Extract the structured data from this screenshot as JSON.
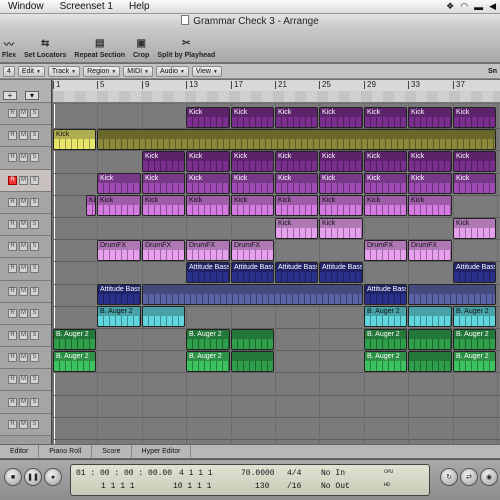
{
  "menubar": {
    "items": [
      "Window",
      "Screenset 1",
      "Help"
    ]
  },
  "window": {
    "title": "Grammar Check 3 - Arrange"
  },
  "toolbar": {
    "buttons": [
      {
        "label": "Flex",
        "icon": "flex-icon"
      },
      {
        "label": "Set Locators",
        "icon": "set-locators-icon"
      },
      {
        "label": "Repeat Section",
        "icon": "repeat-section-icon"
      },
      {
        "label": "Crop",
        "icon": "crop-icon"
      },
      {
        "label": "Split by Playhead",
        "icon": "split-icon"
      }
    ]
  },
  "arrange_menus": [
    "Edit",
    "Track",
    "Region",
    "MIDI",
    "Audio",
    "View"
  ],
  "arrange_first": "4",
  "snap_label": "Sn",
  "ruler": {
    "bars": [
      "1",
      "5",
      "9",
      "13",
      "17",
      "21",
      "25",
      "29",
      "33",
      "37"
    ]
  },
  "tracks": [
    {
      "selected": false,
      "record": false
    },
    {
      "selected": false,
      "record": false
    },
    {
      "selected": false,
      "record": false
    },
    {
      "selected": true,
      "record": true
    },
    {
      "selected": false,
      "record": false
    },
    {
      "selected": false,
      "record": false
    },
    {
      "selected": false,
      "record": false
    },
    {
      "selected": false,
      "record": false
    },
    {
      "selected": false,
      "record": false
    },
    {
      "selected": false,
      "record": false
    },
    {
      "selected": false,
      "record": false
    },
    {
      "selected": false,
      "record": false
    },
    {
      "selected": false,
      "record": false
    },
    {
      "selected": false,
      "record": false
    },
    {
      "selected": false,
      "record": false
    }
  ],
  "colors": {
    "purple": "#7a2f8f",
    "purple_light": "#a04bb5",
    "olive": "#8c8a3a",
    "yellow": "#e8e66a",
    "magenta": "#d47ae0",
    "pink_light": "#e7a0ee",
    "navy": "#2a2f8a",
    "blue_muted": "#5a63a6",
    "cyan": "#5fd7dd",
    "green": "#2e9e4a",
    "green_light": "#3cc25e"
  },
  "regions": [
    {
      "track": 0,
      "start": 13,
      "end": 17,
      "name": "Kick",
      "color": "purple"
    },
    {
      "track": 0,
      "start": 17,
      "end": 21,
      "name": "Kick",
      "color": "purple"
    },
    {
      "track": 0,
      "start": 21,
      "end": 25,
      "name": "Kick",
      "color": "purple"
    },
    {
      "track": 0,
      "start": 25,
      "end": 29,
      "name": "Kick",
      "color": "purple"
    },
    {
      "track": 0,
      "start": 29,
      "end": 33,
      "name": "Kick",
      "color": "purple"
    },
    {
      "track": 0,
      "start": 33,
      "end": 37,
      "name": "Kick",
      "color": "purple"
    },
    {
      "track": 0,
      "start": 37,
      "end": 41,
      "name": "Kick",
      "color": "purple"
    },
    {
      "track": 1,
      "start": 1,
      "end": 5,
      "name": "Kick",
      "color": "yellow"
    },
    {
      "track": 1,
      "start": 5,
      "end": 41,
      "name": "",
      "color": "olive"
    },
    {
      "track": 2,
      "start": 9,
      "end": 13,
      "name": "Kick",
      "color": "purple"
    },
    {
      "track": 2,
      "start": 13,
      "end": 17,
      "name": "Kick",
      "color": "purple"
    },
    {
      "track": 2,
      "start": 17,
      "end": 21,
      "name": "Kick",
      "color": "purple"
    },
    {
      "track": 2,
      "start": 21,
      "end": 25,
      "name": "Kick",
      "color": "purple"
    },
    {
      "track": 2,
      "start": 25,
      "end": 29,
      "name": "Kick",
      "color": "purple"
    },
    {
      "track": 2,
      "start": 29,
      "end": 33,
      "name": "Kick",
      "color": "purple"
    },
    {
      "track": 2,
      "start": 33,
      "end": 37,
      "name": "Kick",
      "color": "purple"
    },
    {
      "track": 2,
      "start": 37,
      "end": 41,
      "name": "Kick",
      "color": "purple"
    },
    {
      "track": 3,
      "start": 5,
      "end": 9,
      "name": "Kick",
      "color": "purple_light"
    },
    {
      "track": 3,
      "start": 9,
      "end": 13,
      "name": "Kick",
      "color": "purple_light"
    },
    {
      "track": 3,
      "start": 13,
      "end": 17,
      "name": "Kick",
      "color": "purple_light"
    },
    {
      "track": 3,
      "start": 17,
      "end": 21,
      "name": "Kick",
      "color": "purple_light"
    },
    {
      "track": 3,
      "start": 21,
      "end": 25,
      "name": "Kick",
      "color": "purple_light"
    },
    {
      "track": 3,
      "start": 25,
      "end": 29,
      "name": "Kick",
      "color": "purple_light"
    },
    {
      "track": 3,
      "start": 29,
      "end": 33,
      "name": "Kick",
      "color": "purple_light"
    },
    {
      "track": 3,
      "start": 33,
      "end": 37,
      "name": "Kick",
      "color": "purple_light"
    },
    {
      "track": 3,
      "start": 37,
      "end": 41,
      "name": "Kick",
      "color": "purple_light"
    },
    {
      "track": 4,
      "start": 4,
      "end": 5,
      "name": "Ki",
      "color": "magenta"
    },
    {
      "track": 4,
      "start": 5,
      "end": 9,
      "name": "Kick",
      "color": "magenta"
    },
    {
      "track": 4,
      "start": 9,
      "end": 13,
      "name": "Kick",
      "color": "magenta"
    },
    {
      "track": 4,
      "start": 13,
      "end": 17,
      "name": "Kick",
      "color": "magenta"
    },
    {
      "track": 4,
      "start": 17,
      "end": 21,
      "name": "Kick",
      "color": "magenta"
    },
    {
      "track": 4,
      "start": 21,
      "end": 25,
      "name": "Kick",
      "color": "magenta"
    },
    {
      "track": 4,
      "start": 25,
      "end": 29,
      "name": "Kick",
      "color": "magenta"
    },
    {
      "track": 4,
      "start": 29,
      "end": 33,
      "name": "Kick",
      "color": "magenta"
    },
    {
      "track": 4,
      "start": 33,
      "end": 37,
      "name": "Kick",
      "color": "magenta"
    },
    {
      "track": 5,
      "start": 21,
      "end": 25,
      "name": "Kick",
      "color": "pink_light"
    },
    {
      "track": 5,
      "start": 25,
      "end": 29,
      "name": "Kick",
      "color": "pink_light"
    },
    {
      "track": 5,
      "start": 37,
      "end": 41,
      "name": "Kick",
      "color": "pink_light"
    },
    {
      "track": 6,
      "start": 5,
      "end": 9,
      "name": "DrumFX",
      "color": "pink_light"
    },
    {
      "track": 6,
      "start": 9,
      "end": 13,
      "name": "DrumFX",
      "color": "pink_light"
    },
    {
      "track": 6,
      "start": 13,
      "end": 17,
      "name": "DrumFX",
      "color": "pink_light"
    },
    {
      "track": 6,
      "start": 17,
      "end": 21,
      "name": "DrumFX",
      "color": "pink_light"
    },
    {
      "track": 6,
      "start": 29,
      "end": 33,
      "name": "DrumFX",
      "color": "pink_light"
    },
    {
      "track": 6,
      "start": 33,
      "end": 37,
      "name": "DrumFX",
      "color": "pink_light"
    },
    {
      "track": 7,
      "start": 13,
      "end": 17,
      "name": "Attitude Bass",
      "color": "navy"
    },
    {
      "track": 7,
      "start": 17,
      "end": 21,
      "name": "Attitude Bass",
      "color": "navy"
    },
    {
      "track": 7,
      "start": 21,
      "end": 25,
      "name": "Attitude Bass",
      "color": "navy"
    },
    {
      "track": 7,
      "start": 25,
      "end": 29,
      "name": "Attitude Bass",
      "color": "navy"
    },
    {
      "track": 7,
      "start": 37,
      "end": 41,
      "name": "Attitude Bass",
      "color": "navy"
    },
    {
      "track": 8,
      "start": 5,
      "end": 9,
      "name": "Attitude Bass",
      "color": "navy"
    },
    {
      "track": 8,
      "start": 9,
      "end": 29,
      "name": "",
      "color": "blue_muted"
    },
    {
      "track": 8,
      "start": 29,
      "end": 33,
      "name": "Attitude Bass",
      "color": "navy"
    },
    {
      "track": 8,
      "start": 33,
      "end": 41,
      "name": "",
      "color": "blue_muted"
    },
    {
      "track": 9,
      "start": 5,
      "end": 9,
      "name": "B. Auger 2",
      "color": "cyan"
    },
    {
      "track": 9,
      "start": 9,
      "end": 13,
      "name": "",
      "color": "cyan"
    },
    {
      "track": 9,
      "start": 29,
      "end": 33,
      "name": "B. Auger 2",
      "color": "cyan"
    },
    {
      "track": 9,
      "start": 33,
      "end": 37,
      "name": "",
      "color": "cyan"
    },
    {
      "track": 9,
      "start": 37,
      "end": 41,
      "name": "B. Auger 2",
      "color": "cyan"
    },
    {
      "track": 10,
      "start": 1,
      "end": 5,
      "name": "B. Auger 2",
      "color": "green"
    },
    {
      "track": 10,
      "start": 13,
      "end": 17,
      "name": "B. Auger 2",
      "color": "green"
    },
    {
      "track": 10,
      "start": 17,
      "end": 21,
      "name": "",
      "color": "green"
    },
    {
      "track": 10,
      "start": 29,
      "end": 33,
      "name": "B. Auger 2",
      "color": "green"
    },
    {
      "track": 10,
      "start": 33,
      "end": 37,
      "name": "",
      "color": "green"
    },
    {
      "track": 10,
      "start": 37,
      "end": 41,
      "name": "B. Auger 2",
      "color": "green"
    },
    {
      "track": 11,
      "start": 1,
      "end": 5,
      "name": "B. Auger 2",
      "color": "green_light"
    },
    {
      "track": 11,
      "start": 13,
      "end": 17,
      "name": "B. Auger 2",
      "color": "green_light"
    },
    {
      "track": 11,
      "start": 17,
      "end": 21,
      "name": "",
      "color": "green"
    },
    {
      "track": 11,
      "start": 29,
      "end": 33,
      "name": "B. Auger 2",
      "color": "green_light"
    },
    {
      "track": 11,
      "start": 33,
      "end": 37,
      "name": "",
      "color": "green"
    },
    {
      "track": 11,
      "start": 37,
      "end": 41,
      "name": "B. Auger 2",
      "color": "green_light"
    }
  ],
  "bottom_tabs": [
    "Editor",
    "Piano Roll",
    "Score",
    "Hyper Editor"
  ],
  "transport": {
    "smpte": "01 : 00 : 00 : 00.00",
    "bars_beats": "1   1   1   1",
    "left_locator": "4   1   1   1",
    "right_locator": "10   1   1   1",
    "tempo": "70.0000",
    "tempo_sub": "130",
    "signature": "4/4",
    "division": "/16",
    "in": "No In",
    "out": "No Out",
    "cpu_label": "CPU",
    "hd_label": "HD"
  }
}
